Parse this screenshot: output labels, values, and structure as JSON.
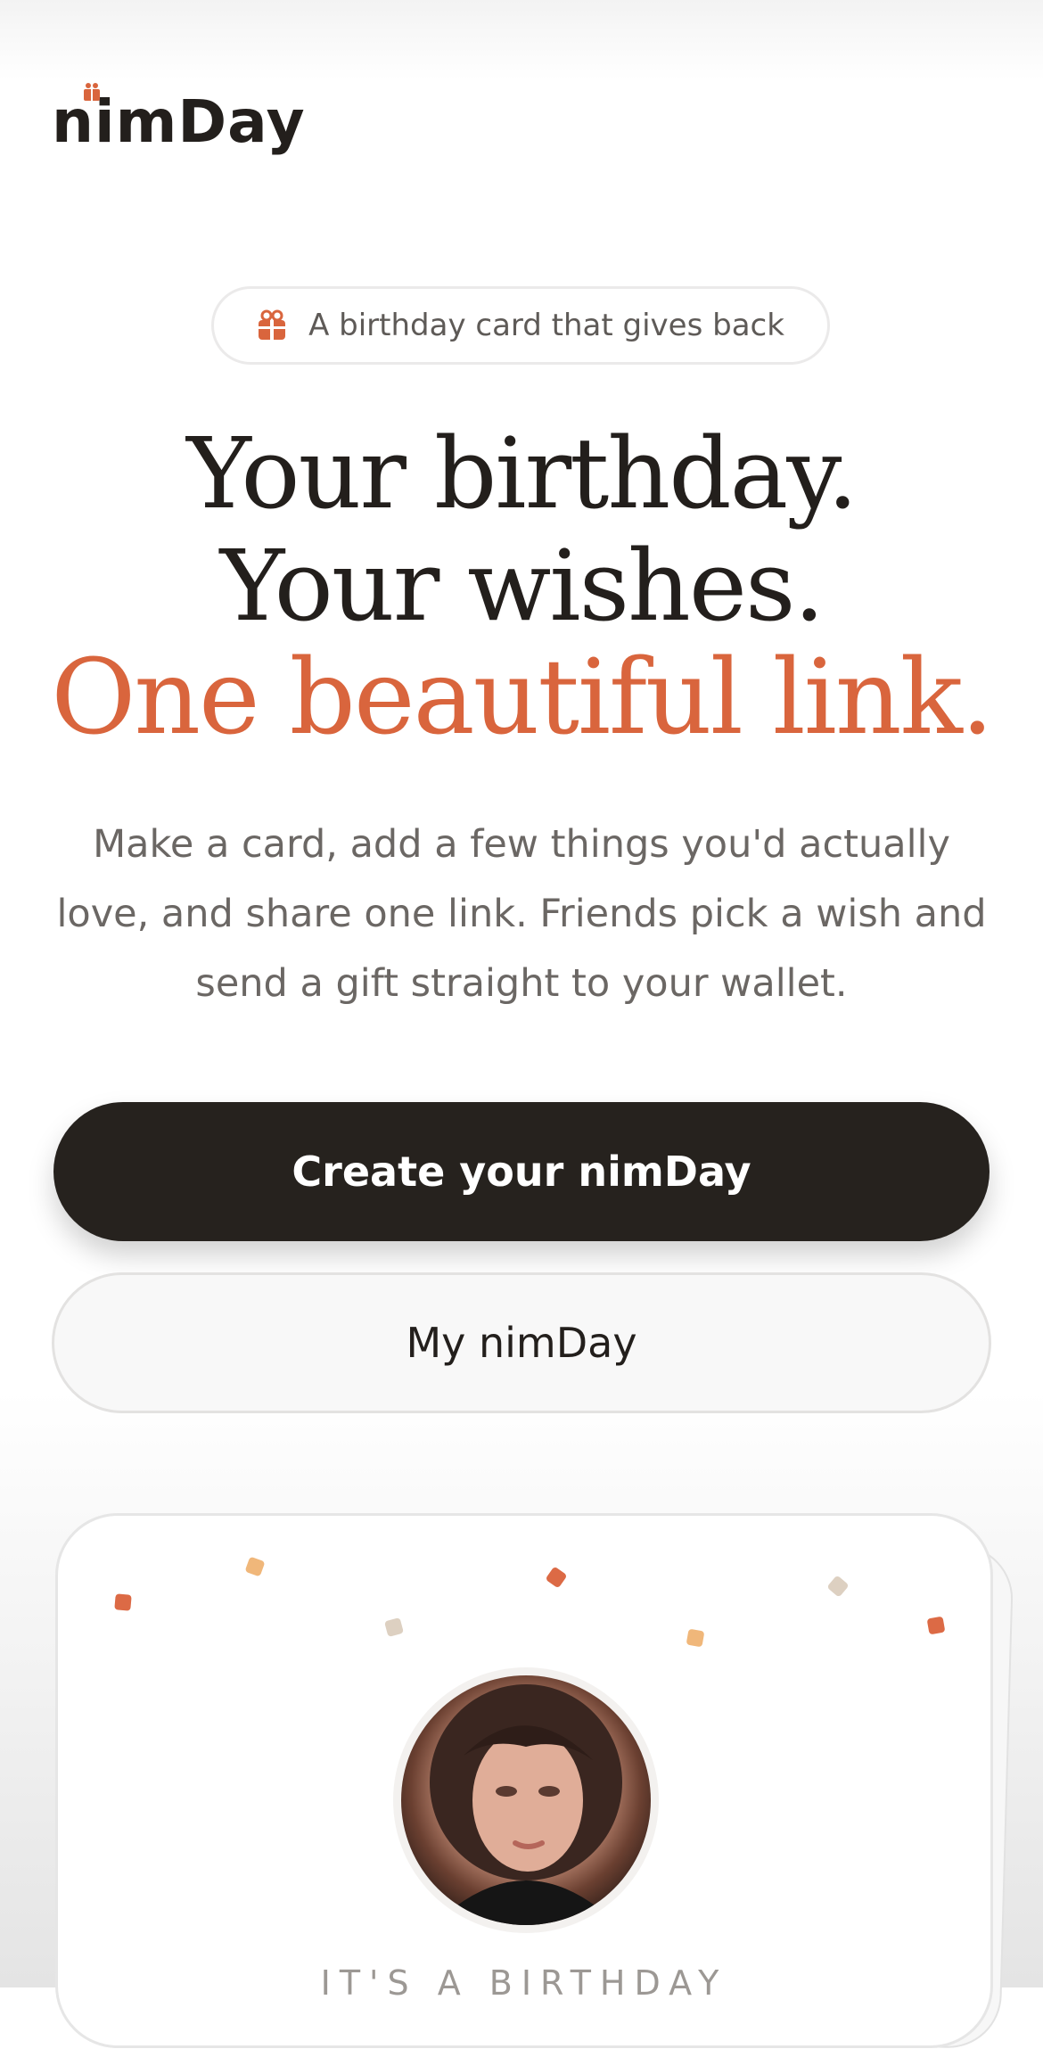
{
  "header": {
    "logo_text": "nimDay",
    "logo_icon": "gift-icon"
  },
  "hero": {
    "pill_icon": "gift-icon",
    "pill_text": "A birthday card that gives back",
    "headline_line1": "Your birthday.",
    "headline_line2": "Your wishes.",
    "headline_accent": "One beautiful link.",
    "description": "Make a card, add a few things you'd actually love, and share one link. Friends pick a wish and send a gift straight to your wallet."
  },
  "actions": {
    "primary_label": "Create your nimDay",
    "secondary_label": "My nimDay"
  },
  "preview_card": {
    "avatar": "profile-photo",
    "eyebrow": "IT'S A BIRTHDAY"
  },
  "colors": {
    "accent": "#d9653d",
    "dark": "#26221e",
    "confetti_orange": "#dc6a45",
    "confetti_peach": "#f0b77a",
    "confetti_beige": "#ddd0c1"
  }
}
